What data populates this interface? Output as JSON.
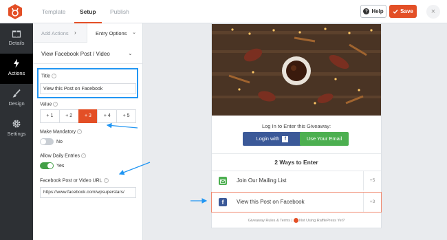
{
  "colors": {
    "accent": "#e34f26",
    "highlight_blue": "#2196f3",
    "facebook": "#3b5998",
    "green": "#4caf50",
    "sidebar_bg": "#2d3034"
  },
  "topbar": {
    "tabs": [
      {
        "label": "Template"
      },
      {
        "label": "Setup"
      },
      {
        "label": "Publish"
      }
    ],
    "help_label": "Help",
    "save_label": "Save",
    "close_glyph": "×"
  },
  "sidebar": {
    "items": [
      {
        "label": "Details",
        "icon": "gift-icon"
      },
      {
        "label": "Actions",
        "icon": "bolt-icon"
      },
      {
        "label": "Design",
        "icon": "brush-icon"
      },
      {
        "label": "Settings",
        "icon": "gear-icon"
      }
    ]
  },
  "panel": {
    "add_actions": "Add Actions",
    "entry_options": "Entry Options",
    "action_title": "View Facebook Post / Video",
    "title_label": "Title",
    "title_value": "View this Post on Facebook",
    "value_label": "Value",
    "value_options": [
      "+ 1",
      "+ 2",
      "+ 3",
      "+ 4",
      "+ 5"
    ],
    "value_selected": "+ 3",
    "mandatory_label": "Make Mandatory",
    "mandatory_state": "No",
    "daily_label": "Allow Daily Entries",
    "daily_state": "Yes",
    "url_label": "Facebook Post or Video URL",
    "url_value": "https://www.facebook.com/wpsuperstars/"
  },
  "preview": {
    "login_prompt": "Log In to Enter this Giveaway:",
    "fb_login": "Login with",
    "fb_glyph": "f",
    "email_button": "Use Your Email",
    "ways_title": "2 Ways to Enter",
    "entries": [
      {
        "label": "Join Our Mailing List",
        "points": "+5",
        "icon": "envelope-icon"
      },
      {
        "label": "View this Post on Facebook",
        "points": "+3",
        "icon": "facebook-icon"
      }
    ],
    "footer_text": "Giveaway Rules & Terms |",
    "footer_link": "Not Using RafflePress Yet?"
  }
}
